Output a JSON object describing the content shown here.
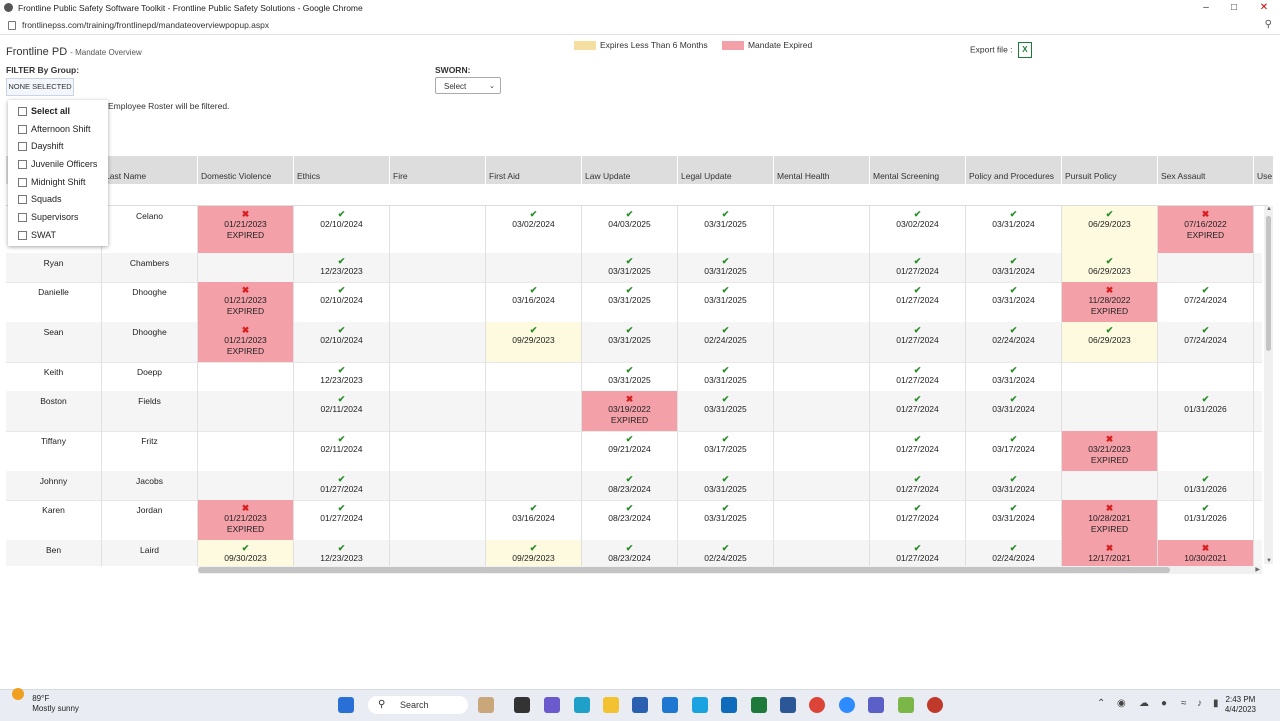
{
  "browser": {
    "title": "Frontline Public Safety Software Toolkit - Frontline Public Safety Solutions - Google Chrome",
    "url": "frontlinepss.com/training/frontlinepd/mandateoverviewpopup.aspx"
  },
  "header": {
    "brand": "Frontline PD",
    "subtitle": "- Mandate Overview",
    "legend": {
      "warn_label": "Expires Less Than 6 Months",
      "expired_label": "Mandate Expired",
      "warn_color": "#f5dfa0",
      "expired_color": "#f4a0a8"
    },
    "export_label": "Export file :"
  },
  "filter": {
    "group_label": "FILTER By Group:",
    "group_button": "NONE SELECTED",
    "sworn_label": "SWORN:",
    "sworn_value": "Select",
    "note": "Employee Roster will be filtered.",
    "options": [
      "Select all",
      "Afternoon Shift",
      "Dayshift",
      "Juvenile Officers",
      "Midnight Shift",
      "Squads",
      "Supervisors",
      "SWAT"
    ]
  },
  "columns": [
    "",
    "Last Name",
    "Domestic Violence",
    "Ethics",
    "Fire",
    "First Aid",
    "Law Update",
    "Legal Update",
    "Mental Health",
    "Mental Screening",
    "Policy and Procedures",
    "Pursuit Policy",
    "Sex Assault",
    "Use"
  ],
  "expired_text": "EXPIRED",
  "rows": [
    {
      "first": "",
      "last": "Celano",
      "cells": [
        {
          "date": "01/21/2023",
          "status": "expired"
        },
        {
          "date": "02/10/2024",
          "status": "ok"
        },
        null,
        {
          "date": "03/02/2024",
          "status": "ok"
        },
        {
          "date": "04/03/2025",
          "status": "ok"
        },
        {
          "date": "03/31/2025",
          "status": "ok"
        },
        null,
        {
          "date": "03/02/2024",
          "status": "ok"
        },
        {
          "date": "03/31/2024",
          "status": "ok"
        },
        {
          "date": "06/29/2023",
          "status": "warn"
        },
        {
          "date": "07/16/2022",
          "status": "expired"
        }
      ]
    },
    {
      "first": "Ryan",
      "last": "Chambers",
      "cells": [
        null,
        {
          "date": "12/23/2023",
          "status": "ok"
        },
        null,
        null,
        {
          "date": "03/31/2025",
          "status": "ok"
        },
        {
          "date": "03/31/2025",
          "status": "ok"
        },
        null,
        {
          "date": "01/27/2024",
          "status": "ok"
        },
        {
          "date": "03/31/2024",
          "status": "ok"
        },
        {
          "date": "06/29/2023",
          "status": "warn"
        },
        null
      ]
    },
    {
      "first": "Danielle",
      "last": "Dhooghe",
      "cells": [
        {
          "date": "01/21/2023",
          "status": "expired"
        },
        {
          "date": "02/10/2024",
          "status": "ok"
        },
        null,
        {
          "date": "03/16/2024",
          "status": "ok"
        },
        {
          "date": "03/31/2025",
          "status": "ok"
        },
        {
          "date": "03/31/2025",
          "status": "ok"
        },
        null,
        {
          "date": "01/27/2024",
          "status": "ok"
        },
        {
          "date": "03/31/2024",
          "status": "ok"
        },
        {
          "date": "11/28/2022",
          "status": "expired"
        },
        {
          "date": "07/24/2024",
          "status": "ok"
        }
      ]
    },
    {
      "first": "Sean",
      "last": "Dhooghe",
      "cells": [
        {
          "date": "01/21/2023",
          "status": "expired"
        },
        {
          "date": "02/10/2024",
          "status": "ok"
        },
        null,
        {
          "date": "09/29/2023",
          "status": "warn"
        },
        {
          "date": "03/31/2025",
          "status": "ok"
        },
        {
          "date": "02/24/2025",
          "status": "ok"
        },
        null,
        {
          "date": "01/27/2024",
          "status": "ok"
        },
        {
          "date": "02/24/2024",
          "status": "ok"
        },
        {
          "date": "06/29/2023",
          "status": "warn"
        },
        {
          "date": "07/24/2024",
          "status": "ok"
        }
      ]
    },
    {
      "first": "Keith",
      "last": "Doepp",
      "cells": [
        null,
        {
          "date": "12/23/2023",
          "status": "ok"
        },
        null,
        null,
        {
          "date": "03/31/2025",
          "status": "ok"
        },
        {
          "date": "03/31/2025",
          "status": "ok"
        },
        null,
        {
          "date": "01/27/2024",
          "status": "ok"
        },
        {
          "date": "03/31/2024",
          "status": "ok"
        },
        null,
        null
      ]
    },
    {
      "first": "Boston",
      "last": "Fields",
      "cells": [
        null,
        {
          "date": "02/11/2024",
          "status": "ok"
        },
        null,
        null,
        {
          "date": "03/19/2022",
          "status": "expired"
        },
        {
          "date": "03/31/2025",
          "status": "ok"
        },
        null,
        {
          "date": "01/27/2024",
          "status": "ok"
        },
        {
          "date": "03/31/2024",
          "status": "ok"
        },
        null,
        {
          "date": "01/31/2026",
          "status": "ok"
        }
      ]
    },
    {
      "first": "Tiffany",
      "last": "Fritz",
      "cells": [
        null,
        {
          "date": "02/11/2024",
          "status": "ok"
        },
        null,
        null,
        {
          "date": "09/21/2024",
          "status": "ok"
        },
        {
          "date": "03/17/2025",
          "status": "ok"
        },
        null,
        {
          "date": "01/27/2024",
          "status": "ok"
        },
        {
          "date": "03/17/2024",
          "status": "ok"
        },
        {
          "date": "03/21/2023",
          "status": "expired"
        },
        null
      ]
    },
    {
      "first": "Johnny",
      "last": "Jacobs",
      "cells": [
        null,
        {
          "date": "01/27/2024",
          "status": "ok"
        },
        null,
        null,
        {
          "date": "08/23/2024",
          "status": "ok"
        },
        {
          "date": "03/31/2025",
          "status": "ok"
        },
        null,
        {
          "date": "01/27/2024",
          "status": "ok"
        },
        {
          "date": "03/31/2024",
          "status": "ok"
        },
        null,
        {
          "date": "01/31/2026",
          "status": "ok"
        }
      ]
    },
    {
      "first": "Karen",
      "last": "Jordan",
      "cells": [
        {
          "date": "01/21/2023",
          "status": "expired"
        },
        {
          "date": "01/27/2024",
          "status": "ok"
        },
        null,
        {
          "date": "03/16/2024",
          "status": "ok"
        },
        {
          "date": "08/23/2024",
          "status": "ok"
        },
        {
          "date": "03/31/2025",
          "status": "ok"
        },
        null,
        {
          "date": "01/27/2024",
          "status": "ok"
        },
        {
          "date": "03/31/2024",
          "status": "ok"
        },
        {
          "date": "10/28/2021",
          "status": "expired"
        },
        {
          "date": "01/31/2026",
          "status": "ok"
        }
      ]
    },
    {
      "first": "Ben",
      "last": "Laird",
      "cells": [
        {
          "date": "09/30/2023",
          "status": "warn"
        },
        {
          "date": "12/23/2023",
          "status": "ok"
        },
        null,
        {
          "date": "09/29/2023",
          "status": "warn"
        },
        {
          "date": "08/23/2024",
          "status": "ok"
        },
        {
          "date": "02/24/2025",
          "status": "ok"
        },
        null,
        {
          "date": "01/27/2024",
          "status": "ok"
        },
        {
          "date": "02/24/2024",
          "status": "ok"
        },
        {
          "date": "12/17/2021",
          "status": "expired"
        },
        {
          "date": "10/30/2021",
          "status": "expired"
        }
      ]
    }
  ],
  "taskbar": {
    "temp": "89°F",
    "weather": "Mostly sunny",
    "search": "Search",
    "time": "2:43 PM",
    "date": "4/4/2023"
  }
}
